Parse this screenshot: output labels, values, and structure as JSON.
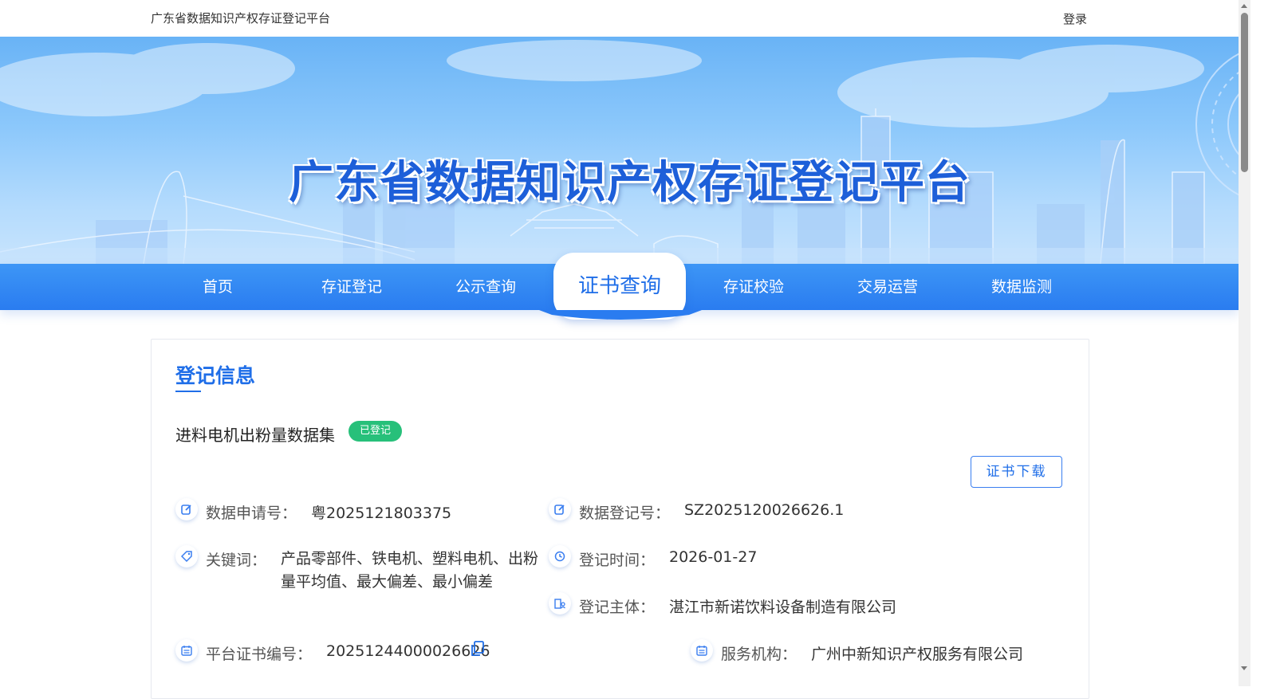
{
  "header": {
    "site_name": "广东省数据知识产权存证登记平台",
    "login": "登录"
  },
  "banner": {
    "title": "广东省数据知识产权存证登记平台"
  },
  "nav": {
    "items": [
      {
        "label": "首页"
      },
      {
        "label": "存证登记"
      },
      {
        "label": "公示查询"
      },
      {
        "label": "证书查询"
      },
      {
        "label": "存证校验"
      },
      {
        "label": "交易运营"
      },
      {
        "label": "数据监测"
      }
    ],
    "active": "证书查询"
  },
  "section": {
    "title": "登记信息"
  },
  "dataset": {
    "name": "进料电机出粉量数据集",
    "status": "已登记"
  },
  "actions": {
    "download": "证书下载"
  },
  "fields": {
    "application_no": {
      "label": "数据申请号：",
      "value": "粤2025121803375"
    },
    "registration_no": {
      "label": "数据登记号：",
      "value": "SZ2025120026626.1"
    },
    "keywords": {
      "label": "关键词：",
      "value": "产品零部件、铁电机、塑料电机、出粉量平均值、最大偏差、最小偏差"
    },
    "registration_time": {
      "label": "登记时间：",
      "value": "2026-01-27"
    },
    "registrant": {
      "label": "登记主体：",
      "value": "湛江市新诺饮料设备制造有限公司"
    },
    "certificate_no": {
      "label": "平台证书编号：",
      "value": "20251244000026626"
    },
    "service_agency": {
      "label": "服务机构：",
      "value": "广州中新知识产权服务有限公司"
    }
  },
  "colors": {
    "primary": "#1f6ee8",
    "nav": "#2a7cf0",
    "badge": "#27c07a"
  }
}
